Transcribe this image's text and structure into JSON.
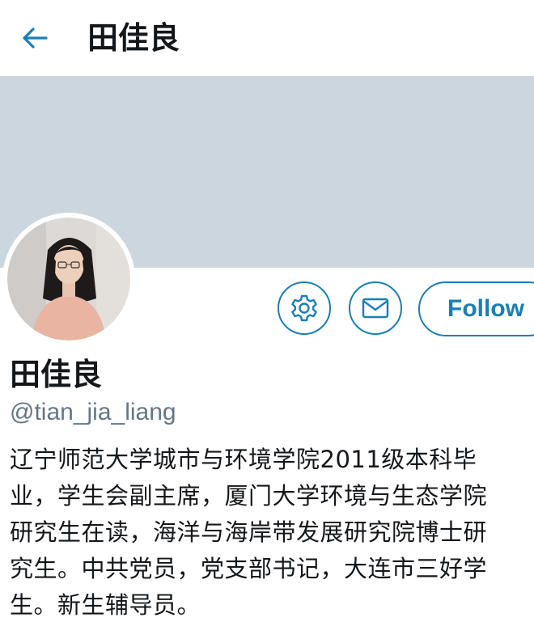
{
  "header": {
    "title": "田佳良",
    "back_icon": "arrow-left-icon"
  },
  "colors": {
    "accent": "#1b7fb4",
    "banner": "#ccd6de",
    "handle_gray": "#657786",
    "text": "#14171a"
  },
  "profile": {
    "display_name": "田佳良",
    "handle": "@tian_jia_liang",
    "avatar_icon": "profile-photo",
    "bio_lines": [
      "辽宁师范大学城市与环境学院2011级本科毕",
      "业，学生会副主席，厦门大学环境与生态学院",
      "研究生在读，海洋与海岸带发展研究院博士研",
      "究生。中共党员，党支部书记，大连市三好学",
      "生。新生辅导员。"
    ]
  },
  "actions": {
    "settings_icon": "gear-icon",
    "message_icon": "envelope-icon",
    "follow_label": "Follow"
  }
}
